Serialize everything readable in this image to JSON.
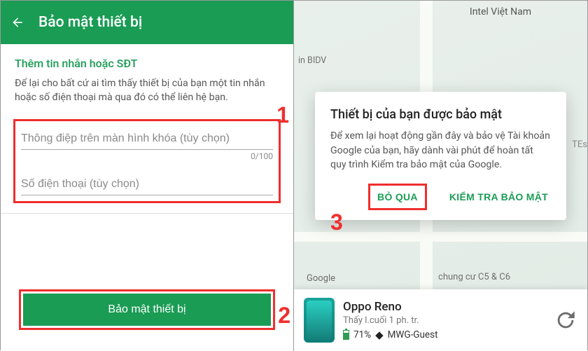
{
  "left": {
    "header_title": "Bảo mật thiết bị",
    "section_title": "Thêm tin nhắn hoặc SĐT",
    "description": "Để lại cho bất cứ ai tìm thấy thiết bị của bạn một tin nhắn hoặc số điện thoại mà qua đó có thể liên hệ bạn.",
    "message_placeholder": "Thông điệp trên màn hình khóa (tùy chọn)",
    "message_counter": "0/100",
    "phone_placeholder": "Số điện thoại (tùy chọn)",
    "primary_button": "Bảo mật thiết bị"
  },
  "right": {
    "map_labels": {
      "intel": "Intel Việt Nam",
      "bidv": "in BIDV",
      "google": "Google",
      "chungcu": "chung cư C5 & C6",
      "text_east": "TEs"
    },
    "modal": {
      "title": "Thiết bị của bạn được bảo mật",
      "body": "Để xem lại hoạt động gần đây và bảo vệ Tài khoản Google của bạn, hãy dành vài phút để hoàn tất quy trình Kiểm tra bảo mật của Google.",
      "skip": "BỎ QUA",
      "check": "KIỂM TRA BẢO MẬT"
    },
    "device": {
      "name": "Oppo Reno",
      "last_seen": "Thấy l.cuối 1 ph. tr.",
      "battery": "71%",
      "wifi": "MWG-Guest"
    }
  },
  "annotations": {
    "n1": "1",
    "n2": "2",
    "n3": "3"
  }
}
